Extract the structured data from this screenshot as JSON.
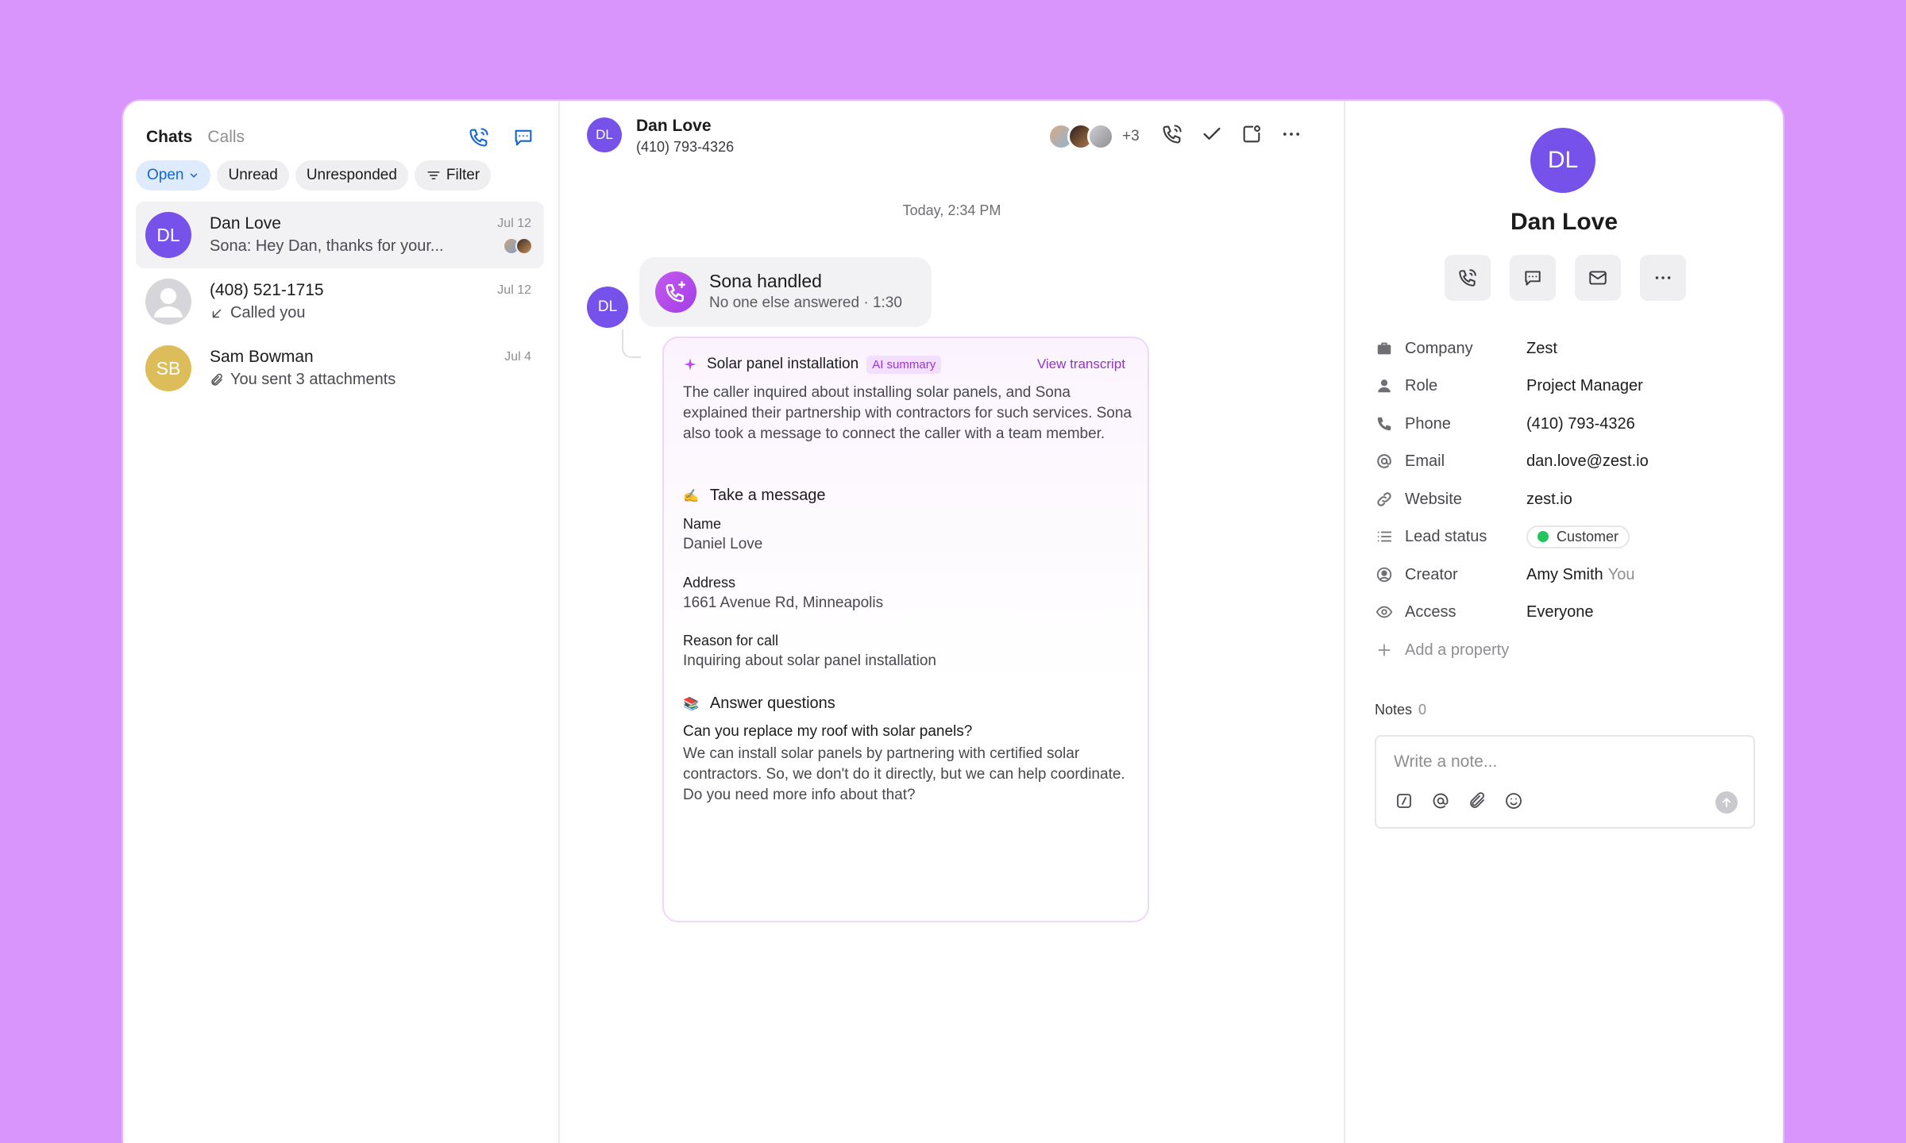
{
  "colors": {
    "background": "#d995fb",
    "accent_purple": "#7651ea",
    "blue": "#1467d2",
    "ai_purple": "#9a36d8",
    "customer_green": "#22c55e",
    "sam_avatar": "#dcbd5a"
  },
  "left": {
    "tabs": [
      {
        "label": "Chats",
        "active": true
      },
      {
        "label": "Calls",
        "active": false
      }
    ],
    "header_icons": [
      "phone-icon",
      "message-icon"
    ],
    "filters": {
      "open": "Open",
      "unread": "Unread",
      "unresponded": "Unresponded",
      "filter": "Filter"
    },
    "conversations": [
      {
        "initials": "DL",
        "name": "Dan Love",
        "preview": "Sona: Hey Dan, thanks for your...",
        "date": "Jul 12",
        "selected": true
      },
      {
        "initials": "",
        "name": "(408) 521-1715",
        "preview": "Called you",
        "date": "Jul 12",
        "selected": false
      },
      {
        "initials": "SB",
        "name": "Sam Bowman",
        "preview": "You sent 3 attachments",
        "date": "Jul 4",
        "selected": false
      }
    ]
  },
  "chat": {
    "header": {
      "initials": "DL",
      "name": "Dan Love",
      "phone": "(410) 793-4326",
      "more_participants": "+3"
    },
    "timestamp": "Today, 2:34 PM",
    "message_avatar": "DL",
    "handled": {
      "title": "Sona handled",
      "subtitle": "No one else answered · 1:30"
    },
    "summary": {
      "title": "Solar panel installation",
      "badge": "AI summary",
      "view_transcript": "View transcript",
      "body": "The caller inquired about installing solar panels, and Sona explained their partnership with contractors for such services. Sona also took a message to connect the caller with a team member.",
      "take_message": {
        "emoji": "✍️",
        "heading": "Take a message",
        "fields": [
          {
            "label": "Name",
            "value": "Daniel Love"
          },
          {
            "label": "Address",
            "value": "1661 Avenue Rd, Minneapolis"
          },
          {
            "label": "Reason for call",
            "value": "Inquiring about solar panel installation"
          }
        ]
      },
      "answer_questions": {
        "emoji": "📚",
        "heading": "Answer questions",
        "question": "Can you replace my roof with solar panels?",
        "answer": "We can install solar panels by partnering with certified solar contractors. So, we don't do it directly, but we can help coordinate. Do you need more info about that?"
      }
    }
  },
  "contact": {
    "initials": "DL",
    "name": "Dan Love",
    "properties": [
      {
        "icon": "briefcase-icon",
        "label": "Company",
        "value": "Zest"
      },
      {
        "icon": "person-icon",
        "label": "Role",
        "value": "Project Manager"
      },
      {
        "icon": "phone-icon",
        "label": "Phone",
        "value": "(410) 793-4326"
      },
      {
        "icon": "at-icon",
        "label": "Email",
        "value": "dan.love@zest.io"
      },
      {
        "icon": "link-icon",
        "label": "Website",
        "value": "zest.io"
      },
      {
        "icon": "list-icon",
        "label": "Lead status",
        "value": "Customer"
      },
      {
        "icon": "user-circle-icon",
        "label": "Creator",
        "value": "Amy Smith",
        "suffix": "You"
      },
      {
        "icon": "eye-icon",
        "label": "Access",
        "value": "Everyone"
      }
    ],
    "add_property": "Add a property",
    "notes_label": "Notes",
    "notes_count": "0",
    "note_placeholder": "Write a note..."
  }
}
